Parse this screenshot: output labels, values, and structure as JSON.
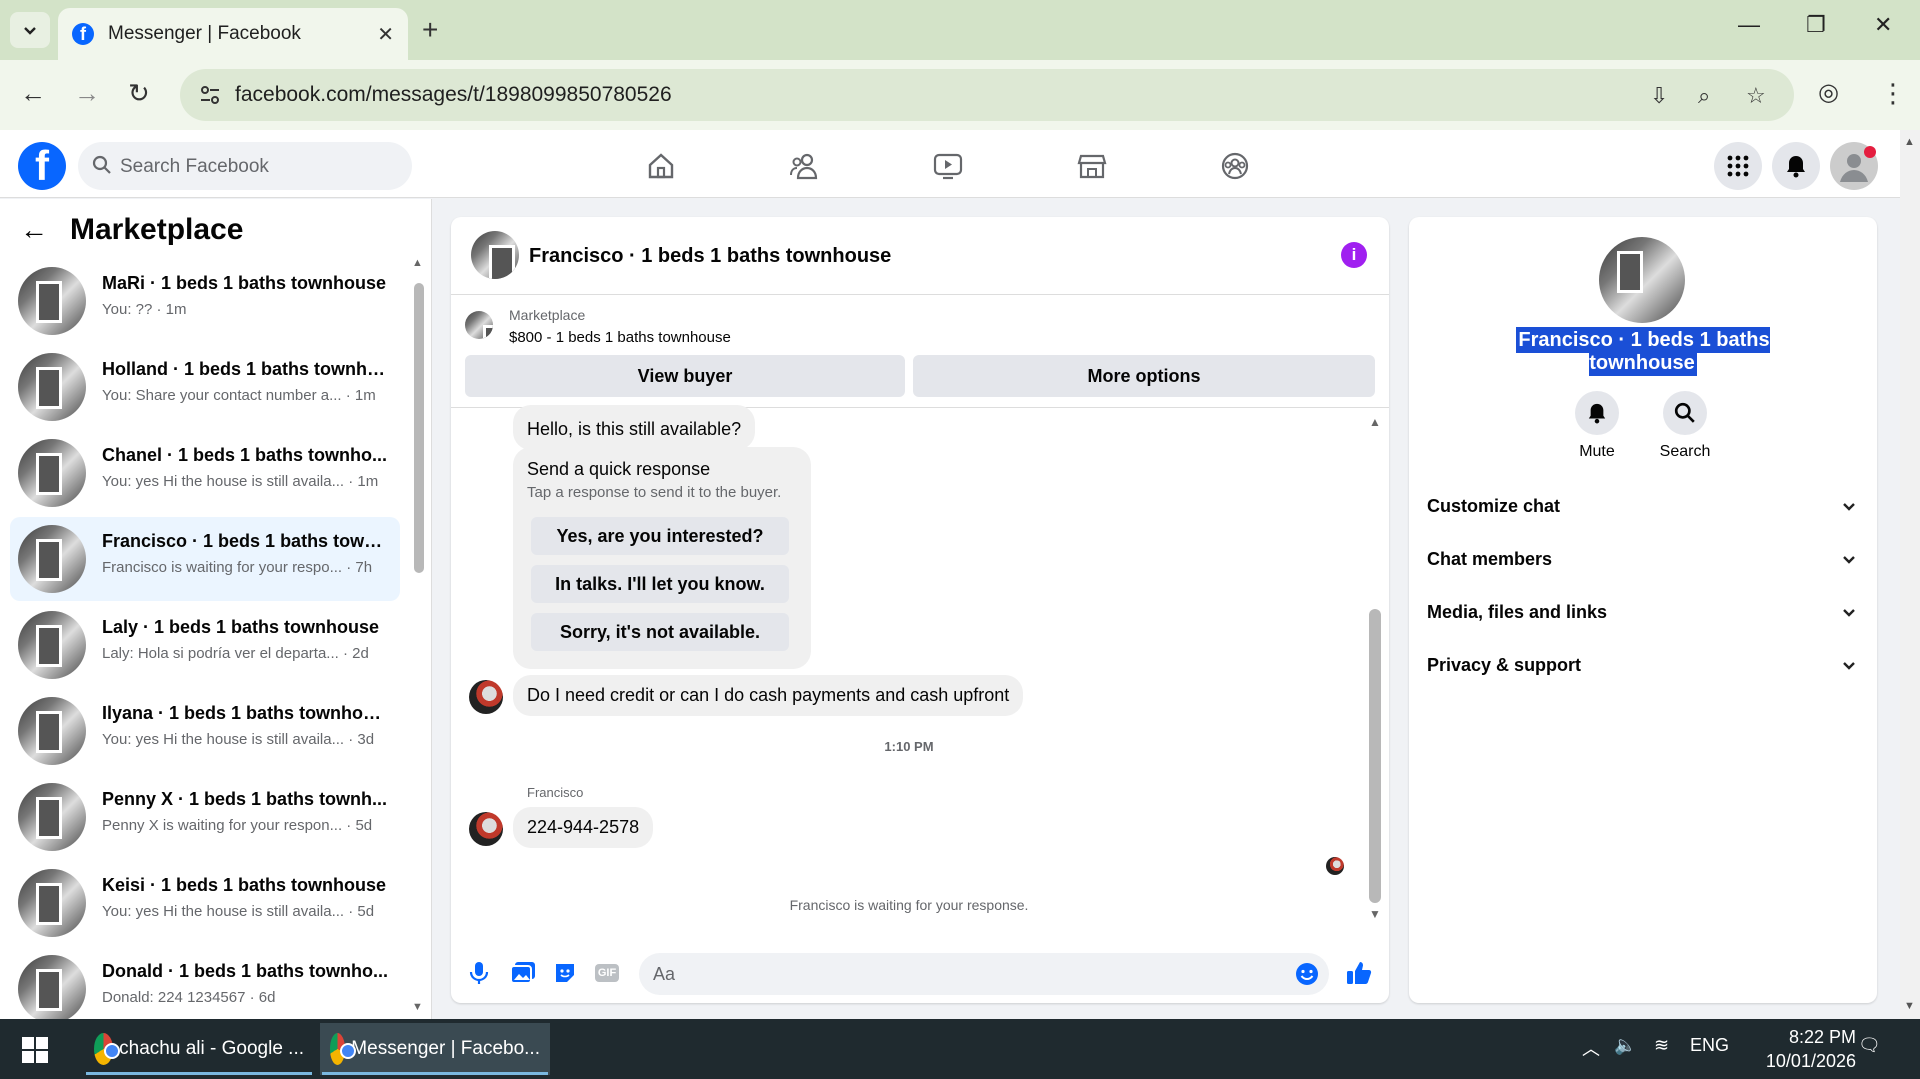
{
  "browser": {
    "tab_title": "Messenger | Facebook",
    "url": "facebook.com/messages/t/1898099850780526"
  },
  "fb": {
    "search_placeholder": "Search Facebook"
  },
  "left": {
    "title": "Marketplace",
    "conversations": [
      {
        "name": "MaRi · 1 beds 1 baths townhouse",
        "sub": "You: ?? · 1m"
      },
      {
        "name": "Holland · 1 beds 1 baths townho...",
        "sub": "You: Share your contact number a... · 1m"
      },
      {
        "name": "Chanel · 1 beds 1 baths townho...",
        "sub": "You: yes Hi the house is still availa... · 1m"
      },
      {
        "name": "Francisco · 1 beds 1 baths townh...",
        "sub": "Francisco is waiting for your respo... · 7h"
      },
      {
        "name": "Laly · 1 beds 1 baths townhouse",
        "sub": "Laly: Hola si podría ver el departa... · 2d"
      },
      {
        "name": "Ilyana · 1 beds 1 baths townhouse",
        "sub": "You: yes Hi the house is still availa... · 3d"
      },
      {
        "name": "Penny X · 1 beds 1 baths townh...",
        "sub": "Penny X is waiting for your respon... · 5d"
      },
      {
        "name": "Keisi · 1 beds 1 baths townhouse",
        "sub": "You: yes Hi the house is still availa... · 5d"
      },
      {
        "name": "Donald · 1 beds 1 baths townho...",
        "sub": "Donald: 224 1234567 · 6d"
      }
    ]
  },
  "chat": {
    "title": "Francisco · 1 beds 1 baths townhouse",
    "marketplace_label": "Marketplace",
    "listing": "$800 - 1 beds 1 baths townhouse",
    "view_buyer": "View buyer",
    "more_options": "More options",
    "msg_hello": "Hello, is this still available?",
    "quick_title": "Send a quick response",
    "quick_sub": "Tap a response to send it to the buyer.",
    "quick_1": "Yes, are you interested?",
    "quick_2": "In talks. I'll let you know.",
    "quick_3": "Sorry, it's not available.",
    "msg_credit": "Do I need credit or can I do cash payments and cash upfront",
    "time": "1:10 PM",
    "sender": "Francisco",
    "msg_phone": "224-944-2578",
    "waiting": "Francisco is waiting for your response.",
    "composer_placeholder": "Aa",
    "gif_label": "GIF"
  },
  "right": {
    "name": "Francisco · 1 beds 1 baths townhouse",
    "mute": "Mute",
    "search": "Search",
    "sections": [
      "Customize chat",
      "Chat members",
      "Media, files and links",
      "Privacy & support"
    ]
  },
  "taskbar": {
    "app1": "chachu ali - Google ...",
    "app2": "Messenger | Facebo...",
    "lang": "ENG",
    "time": "8:22 PM",
    "date": "10/01/2026"
  },
  "colors": {
    "fb_blue": "#0866ff",
    "accent_purple": "#a020f0",
    "selection": "#1a4fd6"
  }
}
